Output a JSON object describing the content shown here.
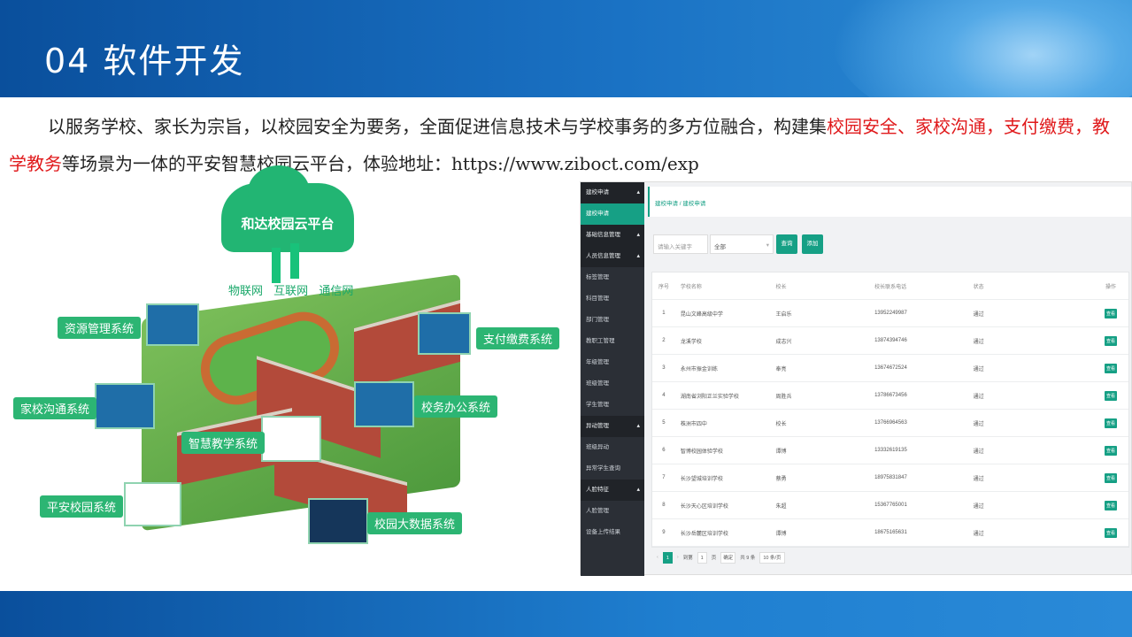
{
  "slide": {
    "title": "04 软件开发",
    "intro_parts": [
      {
        "text": "以服务学校、家长为宗旨，以校园安全为要务，全面促进信息技术与学校事务的多方位融合，构建集",
        "red": false
      },
      {
        "text": "校园安全、家校沟通，支付缴费，教学教务",
        "red": true
      },
      {
        "text": "等场景为一体的平安智慧校园云平台，体验地址：https://www.ziboct.com/exp",
        "red": false
      }
    ]
  },
  "illustration": {
    "cloud_label": "和达校园云平台",
    "network_labels": [
      "物联网",
      "互联网",
      "通信网"
    ],
    "systems": [
      "资源管理系统",
      "支付缴费系统",
      "家校沟通系统",
      "校务办公系统",
      "智慧教学系统",
      "平安校园系统",
      "校园大数据系统"
    ]
  },
  "app": {
    "sidebar": [
      {
        "label": "建校申请",
        "type": "group"
      },
      {
        "label": "建校申请",
        "type": "active"
      },
      {
        "label": "基础信息管理",
        "type": "group"
      },
      {
        "label": "人员信息管理",
        "type": "group"
      },
      {
        "label": "标签管理",
        "type": "item"
      },
      {
        "label": "科目管理",
        "type": "item"
      },
      {
        "label": "部门管理",
        "type": "item"
      },
      {
        "label": "教职工管理",
        "type": "item"
      },
      {
        "label": "年级管理",
        "type": "item"
      },
      {
        "label": "班级管理",
        "type": "item"
      },
      {
        "label": "学生管理",
        "type": "item"
      },
      {
        "label": "异动管理",
        "type": "group"
      },
      {
        "label": "班级异动",
        "type": "item"
      },
      {
        "label": "异常学生查询",
        "type": "item"
      },
      {
        "label": "人脸特征",
        "type": "group"
      },
      {
        "label": "人脸管理",
        "type": "item"
      },
      {
        "label": "设备上传结果",
        "type": "item"
      }
    ],
    "breadcrumb": "建校申请 / 建校申请",
    "toolbar": {
      "search_placeholder": "请输入关键字",
      "select_value": "全部",
      "query_button": "查询",
      "add_button": "添加"
    },
    "table": {
      "columns": [
        "序号",
        "学校名称",
        "校长",
        "校长联系电话",
        "状态",
        "操作"
      ],
      "rows": [
        [
          "1",
          "昆山文峰高级中学",
          "王启乐",
          "13952249987",
          "通过",
          "查看"
        ],
        [
          "2",
          "龙溪学校",
          "成志兴",
          "13874394746",
          "通过",
          "查看"
        ],
        [
          "3",
          "永州市振金训练",
          "奉亮",
          "13674672524",
          "通过",
          "查看"
        ],
        [
          "4",
          "湖南省浏阳正兰实验学校",
          "周胜兵",
          "13786673456",
          "通过",
          "查看"
        ],
        [
          "5",
          "株洲市四中",
          "校长",
          "13766964563",
          "通过",
          "查看"
        ],
        [
          "6",
          "智博校园体验学校",
          "谭博",
          "13332619135",
          "通过",
          "查看"
        ],
        [
          "7",
          "长沙望城培训学校",
          "蔡勇",
          "18975831847",
          "通过",
          "查看"
        ],
        [
          "8",
          "长沙天心区培训学校",
          "朱超",
          "15367765001",
          "通过",
          "查看"
        ],
        [
          "9",
          "长沙岳麓区培训学校",
          "谭博",
          "18675165631",
          "通过",
          "查看"
        ]
      ]
    },
    "pager": {
      "current": "1",
      "goto_label": "到第",
      "page_input": "1",
      "page_unit": "页",
      "confirm": "确定",
      "total": "共 9 条",
      "page_size": "10 条/页"
    }
  }
}
